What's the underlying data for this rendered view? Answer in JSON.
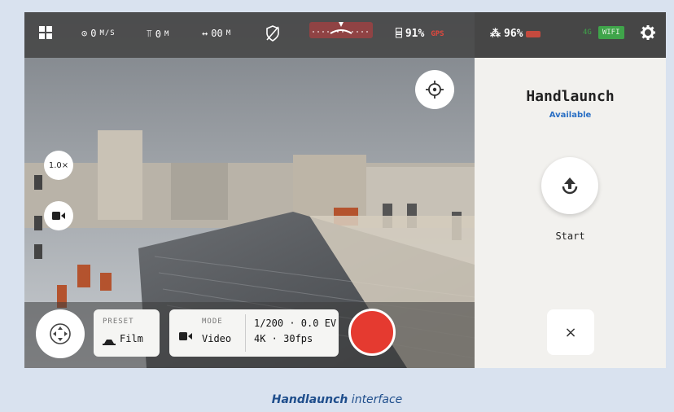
{
  "status_bar": {
    "speed_value": "0",
    "speed_unit": "M/S",
    "altitude_value": "0",
    "altitude_unit": "M",
    "distance_value": "00",
    "distance_unit": "M",
    "controller_battery": "91%",
    "gps_label": "GPS",
    "drone_battery": "96%",
    "network_label": "4G",
    "wifi_label": "WIFI"
  },
  "controls": {
    "zoom_label": "1.0×"
  },
  "preset": {
    "label": "PRESET",
    "value": "Film"
  },
  "mode": {
    "label": "MODE",
    "value": "Video",
    "exposure": "1/200 · 0.0 EV",
    "format": "4K · 30fps"
  },
  "panel": {
    "title": "Handlaunch",
    "subtitle": "Available",
    "start_label": "Start",
    "close_label": "×"
  },
  "caption": {
    "bold": "Handlaunch",
    "rest": " interface"
  },
  "colors": {
    "record": "#e53a30",
    "accent_blue": "#2a6fc4",
    "caption": "#1f4e8c"
  }
}
